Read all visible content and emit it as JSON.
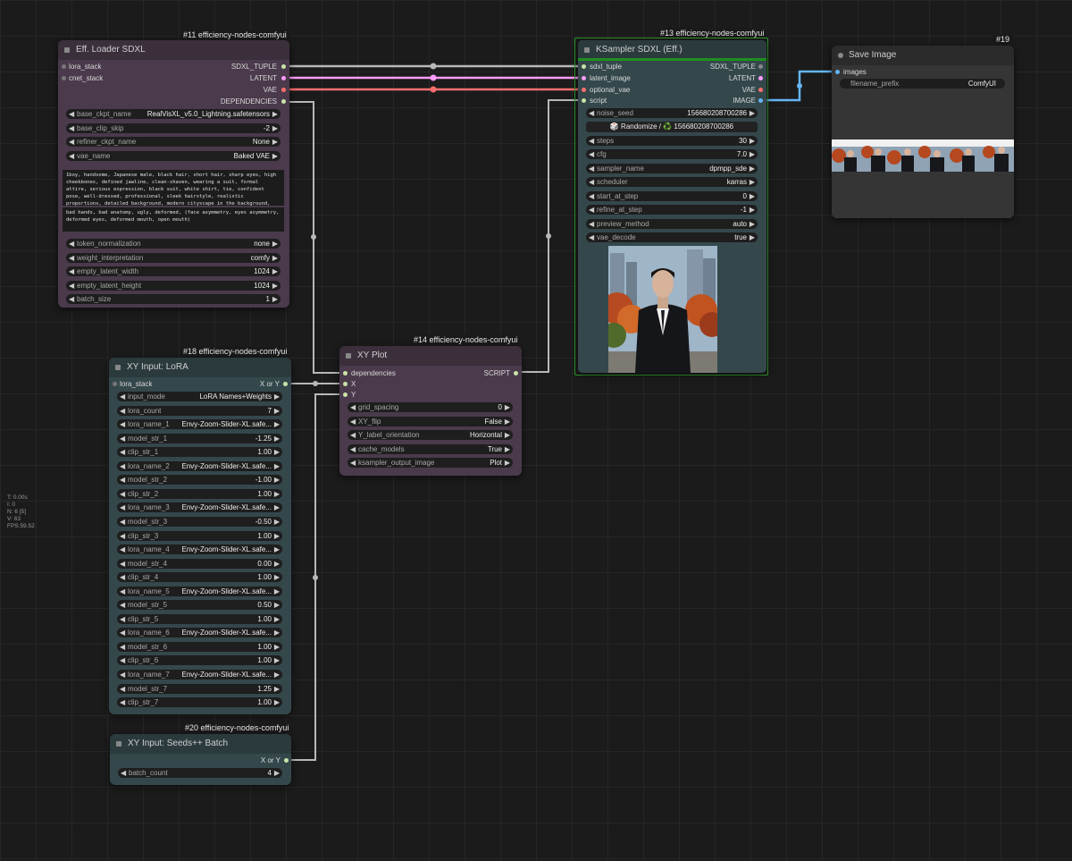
{
  "stats": [
    "T: 0.00s",
    "I: 0",
    "N: 6 [5]",
    "V: 63",
    "FPS:59.52"
  ],
  "colors": {
    "purple_node": "#4a3a4b",
    "teal_node": "#34484c",
    "gray_node": "#353535",
    "wire_tuple": "#b8b8b8",
    "wire_latent": "#ff9cf9",
    "wire_vae": "#ff6e6e",
    "wire_image": "#64b5f6",
    "selected_border": "#2e9e2e"
  },
  "nodes": {
    "loader": {
      "badge": "#11 efficiency-nodes-comfyui",
      "title": "Eff. Loader SDXL",
      "inputs": [
        "lora_stack",
        "cnet_stack"
      ],
      "outputs": [
        "SDXL_TUPLE",
        "LATENT",
        "VAE",
        "DEPENDENCIES"
      ],
      "widgets": [
        {
          "name": "base_ckpt_name",
          "value": "RealVisXL_v5.0_Lightning.safetensors"
        },
        {
          "name": "base_clip_skip",
          "value": "-2"
        },
        {
          "name": "refiner_ckpt_name",
          "value": "None"
        },
        {
          "name": "vae_name",
          "value": "Baked VAE"
        }
      ],
      "positive": "1boy, handsome, Japanese male, black hair, short hair, sharp eyes, high cheekbones, defined jawline, clean-shaven, wearing a suit, formal attire, serious expression, black suit, white shirt, tie, confident pose, well-dressed, professional, sleek hairstyle, realistic proportions, detailed background, modern cityscape in the background, autumn leaves,",
      "negative": "bad hands, bad anatomy, ugly, deformed, (face asymmetry, eyes asymmetry, deformed eyes, deformed mouth, open mouth)",
      "widgets2": [
        {
          "name": "token_normalization",
          "value": "none"
        },
        {
          "name": "weight_interpretation",
          "value": "comfy"
        },
        {
          "name": "empty_latent_width",
          "value": "1024"
        },
        {
          "name": "empty_latent_height",
          "value": "1024"
        },
        {
          "name": "batch_size",
          "value": "1"
        }
      ]
    },
    "ksampler": {
      "badge": "#13 efficiency-nodes-comfyui",
      "title": "KSampler SDXL (Eff.)",
      "inputs": [
        "sdxl_tuple",
        "latent_image",
        "optional_vae",
        "script"
      ],
      "outputs": [
        "SDXL_TUPLE",
        "LATENT",
        "VAE",
        "IMAGE"
      ],
      "noise_seed": {
        "name": "noise_seed",
        "value": "156680208700286"
      },
      "randomize": "🎲 Randomize / ♻️ 156680208700286",
      "widgets": [
        {
          "name": "steps",
          "value": "30"
        },
        {
          "name": "cfg",
          "value": "7.0"
        },
        {
          "name": "sampler_name",
          "value": "dpmpp_sde"
        },
        {
          "name": "scheduler",
          "value": "karras"
        },
        {
          "name": "start_at_step",
          "value": "0"
        },
        {
          "name": "refine_at_step",
          "value": "-1"
        },
        {
          "name": "preview_method",
          "value": "auto"
        },
        {
          "name": "vae_decode",
          "value": "true"
        }
      ]
    },
    "save": {
      "badge": "#19",
      "title": "Save Image",
      "input": "images",
      "widget": {
        "name": "filename_prefix",
        "value": "ComfyUI"
      }
    },
    "xyplot": {
      "badge": "#14 efficiency-nodes-comfyui",
      "title": "XY Plot",
      "inputs": [
        "dependencies",
        "X",
        "Y"
      ],
      "output": "SCRIPT",
      "widgets": [
        {
          "name": "grid_spacing",
          "value": "0"
        },
        {
          "name": "XY_flip",
          "value": "False"
        },
        {
          "name": "Y_label_orientation",
          "value": "Horizontal"
        },
        {
          "name": "cache_models",
          "value": "True"
        },
        {
          "name": "ksampler_output_image",
          "value": "Plot"
        }
      ]
    },
    "lora": {
      "badge": "#18 efficiency-nodes-comfyui",
      "title": "XY Input: LoRA",
      "input": "lora_stack",
      "output": "X or Y",
      "widgets": [
        {
          "name": "input_mode",
          "value": "LoRA Names+Weights"
        },
        {
          "name": "lora_count",
          "value": "7"
        },
        {
          "name": "lora_name_1",
          "value": "Envy-Zoom-Slider-XL.safe..."
        },
        {
          "name": "model_str_1",
          "value": "-1.25"
        },
        {
          "name": "clip_str_1",
          "value": "1.00"
        },
        {
          "name": "lora_name_2",
          "value": "Envy-Zoom-Slider-XL.safe..."
        },
        {
          "name": "model_str_2",
          "value": "-1.00"
        },
        {
          "name": "clip_str_2",
          "value": "1.00"
        },
        {
          "name": "lora_name_3",
          "value": "Envy-Zoom-Slider-XL.safe..."
        },
        {
          "name": "model_str_3",
          "value": "-0.50"
        },
        {
          "name": "clip_str_3",
          "value": "1.00"
        },
        {
          "name": "lora_name_4",
          "value": "Envy-Zoom-Slider-XL.safe..."
        },
        {
          "name": "model_str_4",
          "value": "0.00"
        },
        {
          "name": "clip_str_4",
          "value": "1.00"
        },
        {
          "name": "lora_name_5",
          "value": "Envy-Zoom-Slider-XL.safe..."
        },
        {
          "name": "model_str_5",
          "value": "0.50"
        },
        {
          "name": "clip_str_5",
          "value": "1.00"
        },
        {
          "name": "lora_name_6",
          "value": "Envy-Zoom-Slider-XL.safe..."
        },
        {
          "name": "model_str_6",
          "value": "1.00"
        },
        {
          "name": "clip_str_6",
          "value": "1.00"
        },
        {
          "name": "lora_name_7",
          "value": "Envy-Zoom-Slider-XL.safe..."
        },
        {
          "name": "model_str_7",
          "value": "1.25"
        },
        {
          "name": "clip_str_7",
          "value": "1.00"
        }
      ]
    },
    "seeds": {
      "badge": "#20 efficiency-nodes-comfyui",
      "title": "XY Input: Seeds++ Batch",
      "output": "X or Y",
      "widget": {
        "name": "batch_count",
        "value": "4"
      }
    }
  }
}
